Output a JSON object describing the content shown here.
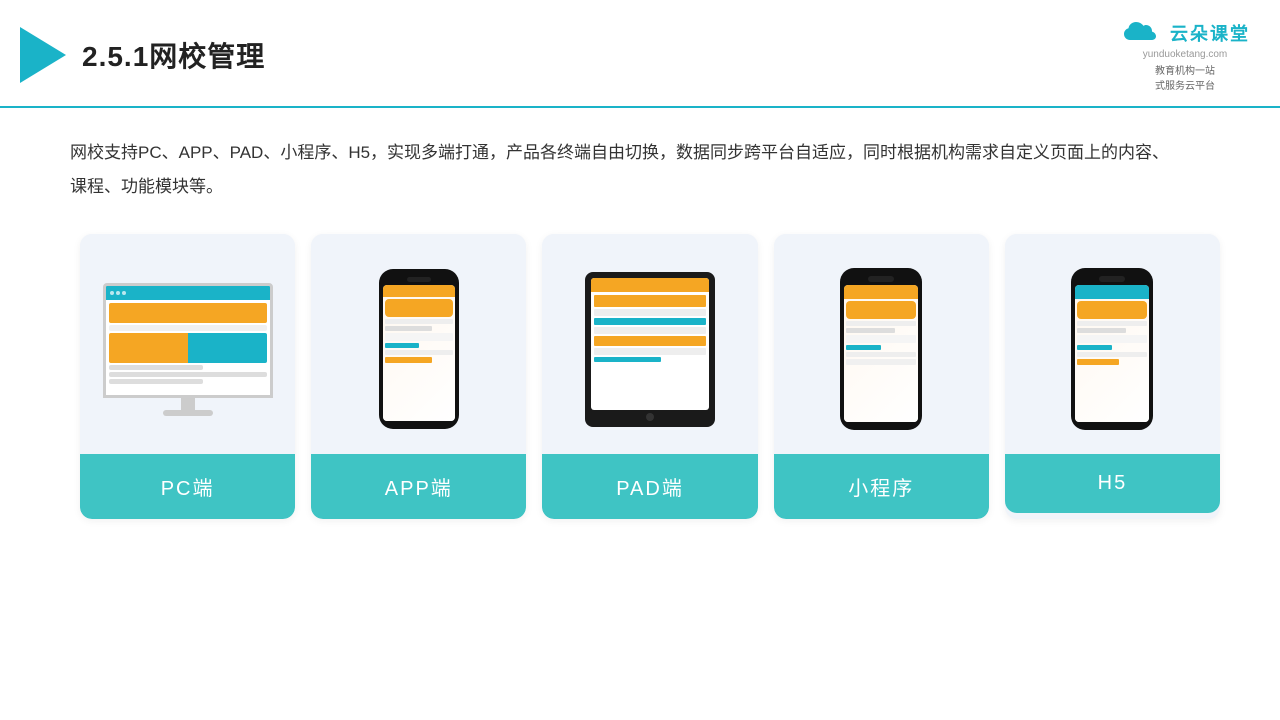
{
  "header": {
    "title": "2.5.1网校管理",
    "logo_cn": "云朵课堂",
    "logo_url": "yunduoketang.com",
    "logo_tagline_line1": "教育机构一站",
    "logo_tagline_line2": "式服务云平台"
  },
  "description": {
    "text": "网校支持PC、APP、PAD、小程序、H5，实现多端打通，产品各终端自由切换，数据同步跨平台自适应，同时根据机构需求自定义页面上的内容、课程、功能模块等。"
  },
  "cards": [
    {
      "id": "pc",
      "label": "PC端",
      "device": "monitor"
    },
    {
      "id": "app",
      "label": "APP端",
      "device": "phone"
    },
    {
      "id": "pad",
      "label": "PAD端",
      "device": "tablet"
    },
    {
      "id": "miniprogram",
      "label": "小程序",
      "device": "phone"
    },
    {
      "id": "h5",
      "label": "H5",
      "device": "phone"
    }
  ]
}
